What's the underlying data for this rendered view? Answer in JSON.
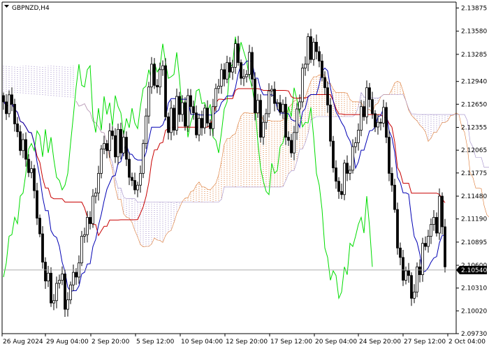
{
  "chart_data": {
    "type": "candlestick",
    "symbol_label": "GBPNZD,H4",
    "y_ticks": [
      2.13875,
      2.1358,
      2.13285,
      2.1294,
      2.1265,
      2.12355,
      2.12065,
      2.11775,
      2.1148,
      2.1119,
      2.10895,
      2.106,
      2.1031,
      2.1002,
      2.0973
    ],
    "x_ticks": [
      "26 Aug 2024",
      "29 Aug 04:00",
      "2 Sep 20:00",
      "5 Sep 12:00",
      "10 Sep 04:00",
      "12 Sep 20:00",
      "17 Sep 12:00",
      "20 Sep 04:00",
      "24 Sep 20:00",
      "27 Sep 12:00",
      "2 Oct 04:00"
    ],
    "current_price": "2.10540",
    "ylim": [
      2.0973,
      2.1395
    ],
    "colors": {
      "candle": "#000000",
      "tenkan": "#0000b4",
      "kijun": "#c80000",
      "chikou": "#00dc00",
      "kumo_bull": "#dc7832",
      "kumo_bear": "#a08cc8",
      "price_line": "#a0a0a0",
      "grid": "none"
    },
    "series": {
      "close": [
        2.1268,
        2.1253,
        2.1277,
        2.1265,
        2.124,
        2.123,
        2.1206,
        2.122,
        2.1195,
        2.1178,
        2.1183,
        2.1155,
        2.112,
        2.11,
        2.1064,
        2.104,
        2.105,
        2.1012,
        2.1015,
        2.1037,
        2.1041,
        2.1049,
        2.1004,
        2.1016,
        2.1035,
        2.1051,
        2.1045,
        2.1063,
        2.1097,
        2.1099,
        2.1121,
        2.1113,
        2.1148,
        2.1152,
        2.1177,
        2.1208,
        2.1215,
        2.1206,
        2.1231,
        2.1225,
        2.1198,
        2.1233,
        2.1203,
        2.1223,
        2.1195,
        2.1172,
        2.1168,
        2.1156,
        2.1162,
        2.1177,
        2.1215,
        2.125,
        2.1287,
        2.1316,
        2.1289,
        2.1287,
        2.1309,
        2.1314,
        2.1249,
        2.1229,
        2.126,
        2.1232,
        2.1275,
        2.1252,
        2.1267,
        2.1237,
        2.1276,
        2.1262,
        2.1254,
        2.1226,
        2.1247,
        2.1235,
        2.126,
        2.1241,
        2.1234,
        2.1262,
        2.1285,
        2.1288,
        2.1309,
        2.1297,
        2.1318,
        2.1306,
        2.1312,
        2.1342,
        2.1318,
        2.1298,
        2.13,
        2.1303,
        2.1331,
        2.1297,
        2.1254,
        2.127,
        2.1223,
        2.1242,
        2.1253,
        2.1282,
        2.1284,
        2.1266,
        2.1267,
        2.1255,
        2.1265,
        2.1223,
        2.1219,
        2.1203,
        2.1229,
        2.1259,
        2.1268,
        2.1311,
        2.1316,
        2.1351,
        2.1322,
        2.1344,
        2.1332,
        2.132,
        2.1299,
        2.1286,
        2.1264,
        2.1218,
        2.1184,
        2.1167,
        2.1154,
        2.115,
        2.119,
        2.1177,
        2.1181,
        2.1211,
        2.1216,
        2.1232,
        2.1262,
        2.1249,
        2.1286,
        2.1271,
        2.1253,
        2.1236,
        2.1242,
        2.1241,
        2.1261,
        2.1223,
        2.1177,
        2.1162,
        2.1131,
        2.1082,
        2.107,
        2.1041,
        2.1053,
        2.1047,
        2.1018,
        2.1026,
        2.1058,
        2.1048,
        2.1088,
        2.1084,
        2.1097,
        2.1112,
        2.1121,
        2.1101,
        2.1148,
        2.1109,
        2.1058
      ]
    },
    "title": "",
    "xlabel": "",
    "ylabel": ""
  }
}
